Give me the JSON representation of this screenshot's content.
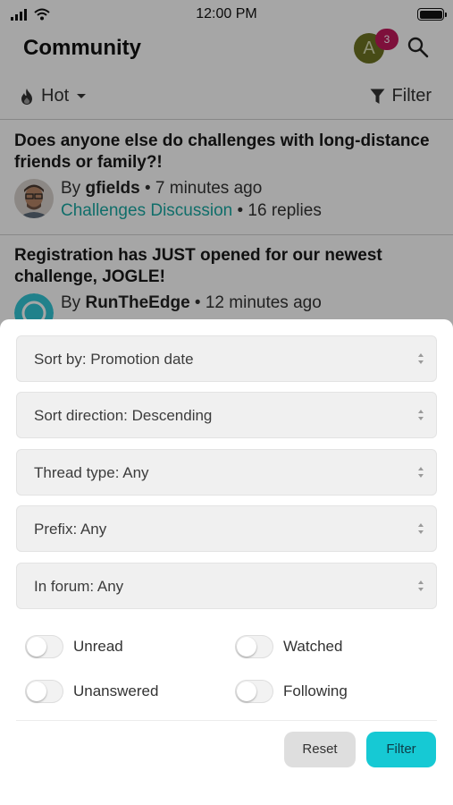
{
  "status_bar": {
    "time": "12:00 PM"
  },
  "header": {
    "title": "Community",
    "avatar_letter": "A",
    "notification_count": "3"
  },
  "toolbar": {
    "sort_label": "Hot",
    "filter_label": "Filter"
  },
  "threads": [
    {
      "title": "Does anyone else do challenges with long-distance friends or family?!",
      "by": "By",
      "author": "gfields",
      "time": "• 7 minutes ago",
      "forum": "Challenges Discussion",
      "replies": "• 16 replies"
    },
    {
      "title": "Registration has JUST opened for our newest challenge, JOGLE!",
      "by": "By",
      "author": "RunTheEdge",
      "time": "• 12 minutes ago"
    }
  ],
  "filter_sheet": {
    "selects": [
      {
        "label": "Sort by: Promotion date"
      },
      {
        "label": "Sort direction: Descending"
      },
      {
        "label": "Thread type: Any"
      },
      {
        "label": "Prefix: Any"
      },
      {
        "label": "In forum: Any"
      }
    ],
    "toggles": [
      {
        "label": "Unread",
        "on": false
      },
      {
        "label": "Watched",
        "on": false
      },
      {
        "label": "Unanswered",
        "on": false
      },
      {
        "label": "Following",
        "on": false
      }
    ],
    "reset_label": "Reset",
    "filter_label": "Filter"
  },
  "colors": {
    "accent": "#16c9d4",
    "link": "#1aa9a3",
    "badge": "#c2195b",
    "avatar": "#6d7423"
  }
}
